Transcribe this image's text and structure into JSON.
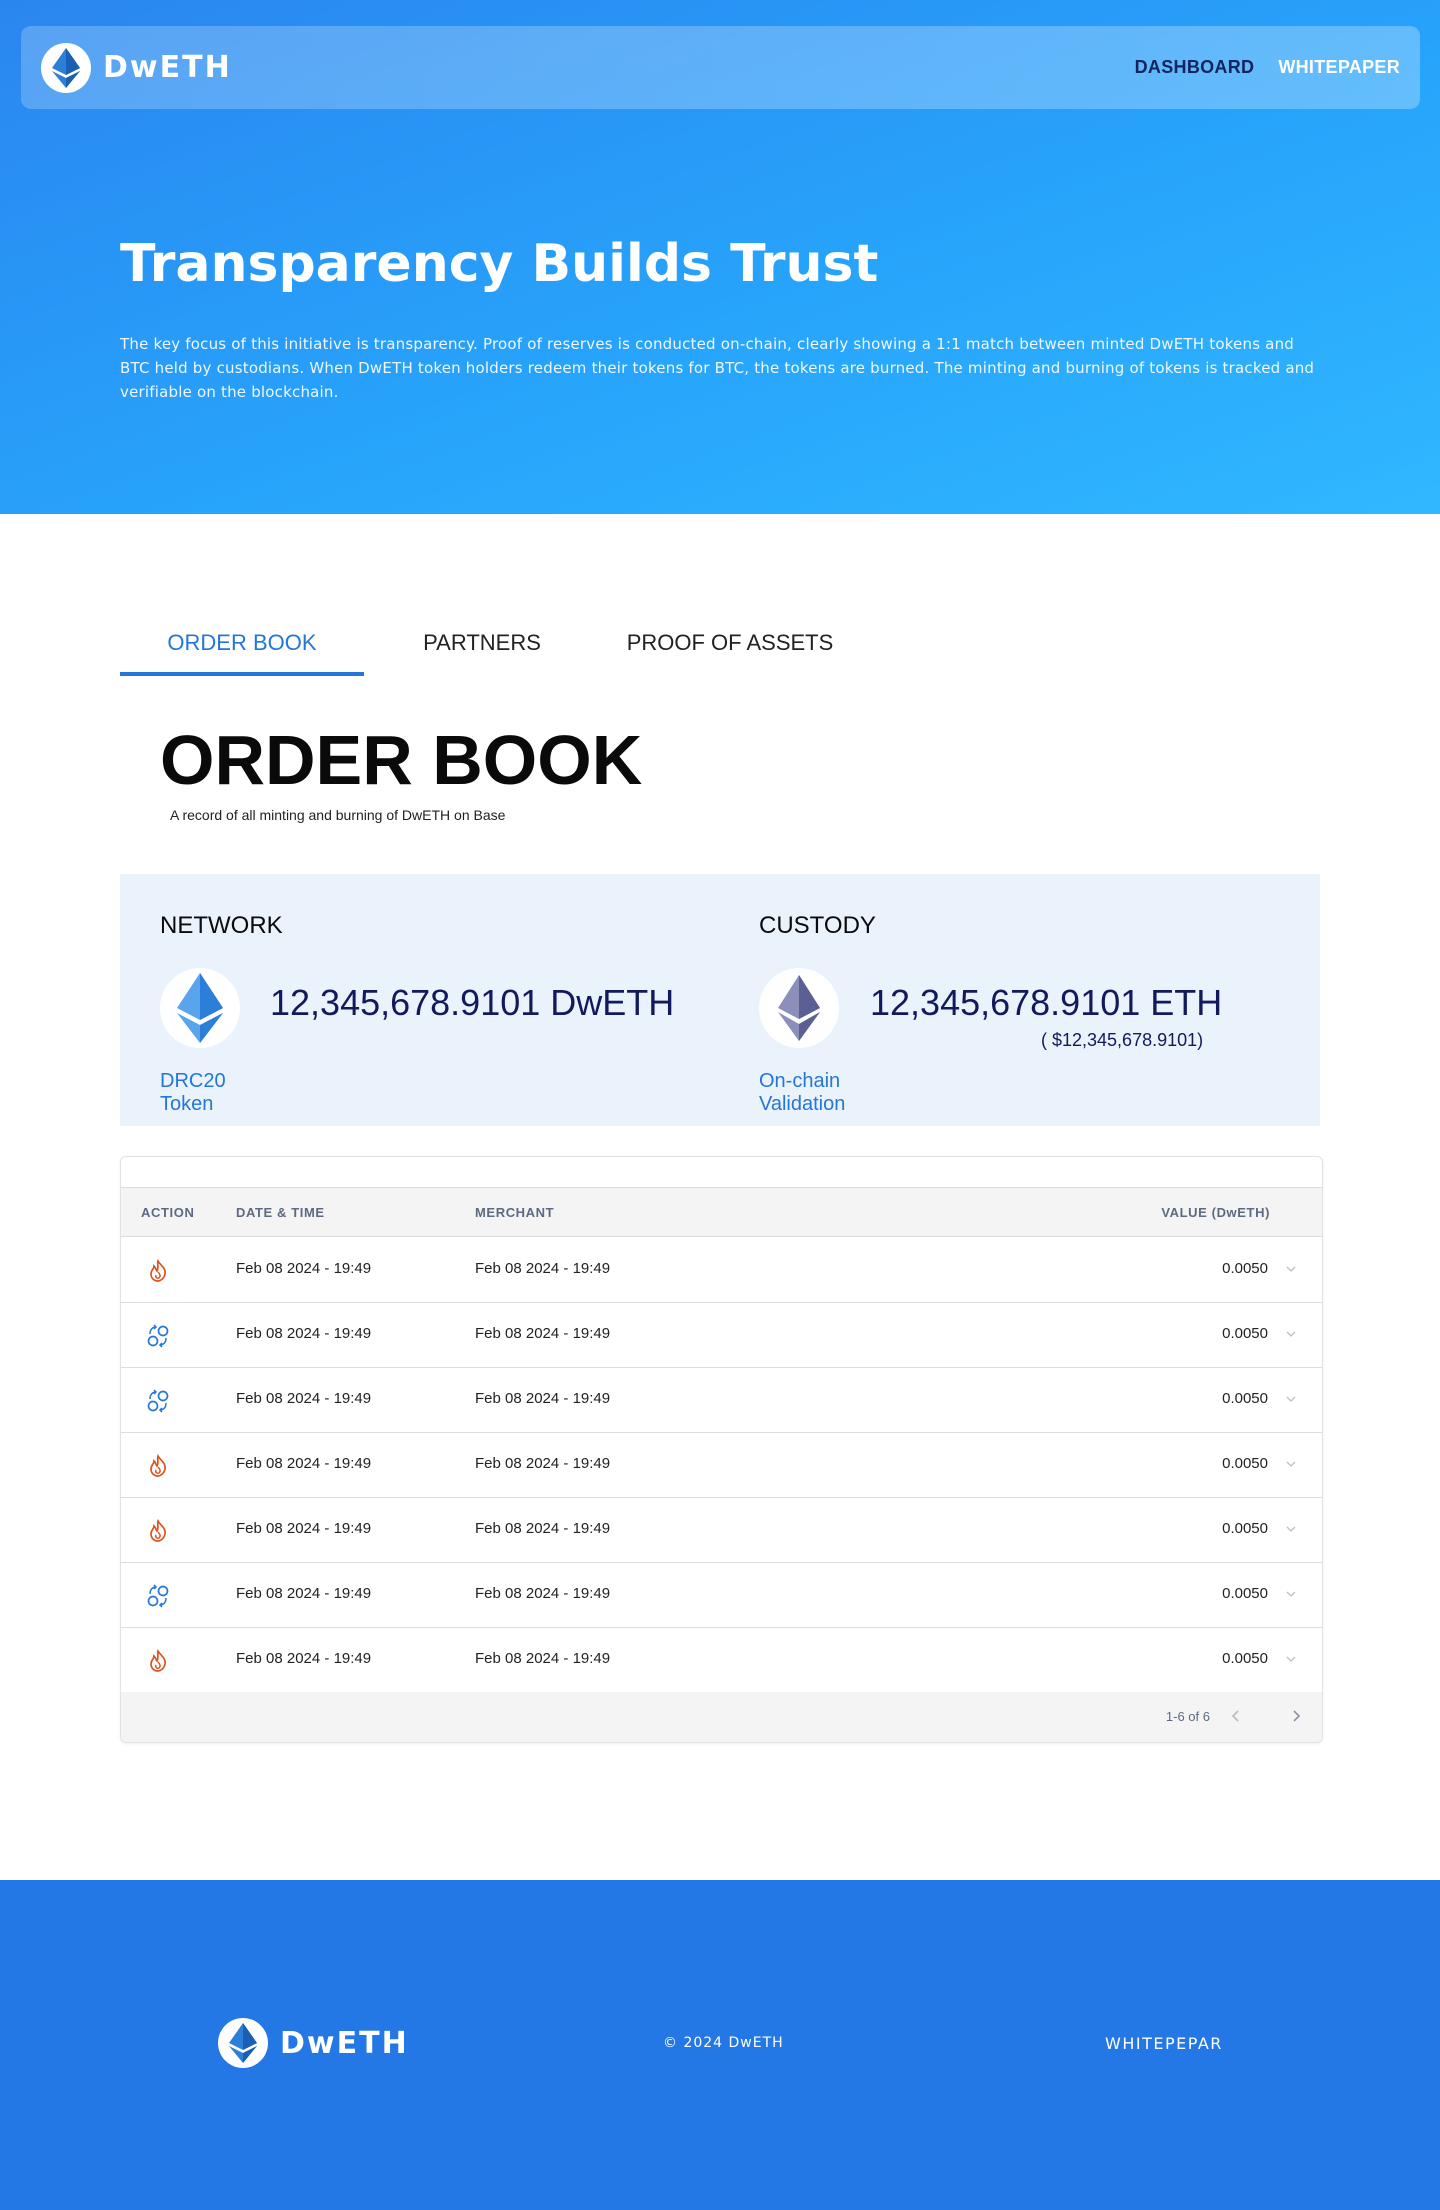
{
  "brand": {
    "name": "DwETH",
    "logo_icon": "ethereum-icon"
  },
  "nav": {
    "items": [
      {
        "label": "DASHBOARD",
        "active": true
      },
      {
        "label": "WHITEPAPER",
        "active": false
      }
    ]
  },
  "hero": {
    "title": "Transparency Builds Trust",
    "description": "The key focus of this initiative is transparency. Proof of reserves is conducted on-chain, clearly showing a 1:1 match between minted DwETH tokens and BTC held by custodians. When DwETH token holders redeem their tokens for BTC, the tokens are burned. The minting and burning of tokens is tracked and verifiable on the blockchain."
  },
  "tabs": [
    {
      "label": "ORDER BOOK",
      "active": true
    },
    {
      "label": "PARTNERS",
      "active": false
    },
    {
      "label": "PROOF OF ASSETS",
      "active": false
    }
  ],
  "section": {
    "title": "ORDER BOOK",
    "subtitle": "A record of all minting and burning of DwETH on Base"
  },
  "stats": {
    "network": {
      "heading": "NETWORK",
      "value": "12,345,678.9101  DwETH",
      "link": "DRC20 Token",
      "icon": "ethereum-blue-icon"
    },
    "custody": {
      "heading": "CUSTODY",
      "value": "12,345,678.9101 ETH",
      "usd": "( $12,345,678.9101)",
      "link": "On-chain Validation",
      "icon": "ethereum-gray-icon"
    }
  },
  "table": {
    "columns": {
      "action": "ACTION",
      "date": "DATE & TIME",
      "merchant": "MERCHANT",
      "value": "VALUE (DwETH)"
    },
    "rows": [
      {
        "action": "burn",
        "date": "Feb 08 2024 - 19:49",
        "merchant": "Feb 08 2024 - 19:49",
        "value": "0.0050"
      },
      {
        "action": "mint",
        "date": "Feb 08 2024 - 19:49",
        "merchant": "Feb 08 2024 - 19:49",
        "value": "0.0050"
      },
      {
        "action": "mint",
        "date": "Feb 08 2024 - 19:49",
        "merchant": "Feb 08 2024 - 19:49",
        "value": "0.0050"
      },
      {
        "action": "burn",
        "date": "Feb 08 2024 - 19:49",
        "merchant": "Feb 08 2024 - 19:49",
        "value": "0.0050"
      },
      {
        "action": "burn",
        "date": "Feb 08 2024 - 19:49",
        "merchant": "Feb 08 2024 - 19:49",
        "value": "0.0050"
      },
      {
        "action": "mint",
        "date": "Feb 08 2024 - 19:49",
        "merchant": "Feb 08 2024 - 19:49",
        "value": "0.0050"
      },
      {
        "action": "burn",
        "date": "Feb 08 2024 - 19:49",
        "merchant": "Feb 08 2024 - 19:49",
        "value": "0.0050"
      }
    ],
    "pagination": "1-6 of 6"
  },
  "footer": {
    "brand": "DwETH",
    "copyright": "© 2024 DwETH",
    "link": "WHITEPEPAR"
  },
  "colors": {
    "hero_start": "#2a86ef",
    "hero_end": "#30b8ff",
    "accent": "#2476d9",
    "footer": "#2378e6",
    "burn": "#e0521d",
    "mint": "#2476d9",
    "stats_bg": "#eaf2fc"
  }
}
